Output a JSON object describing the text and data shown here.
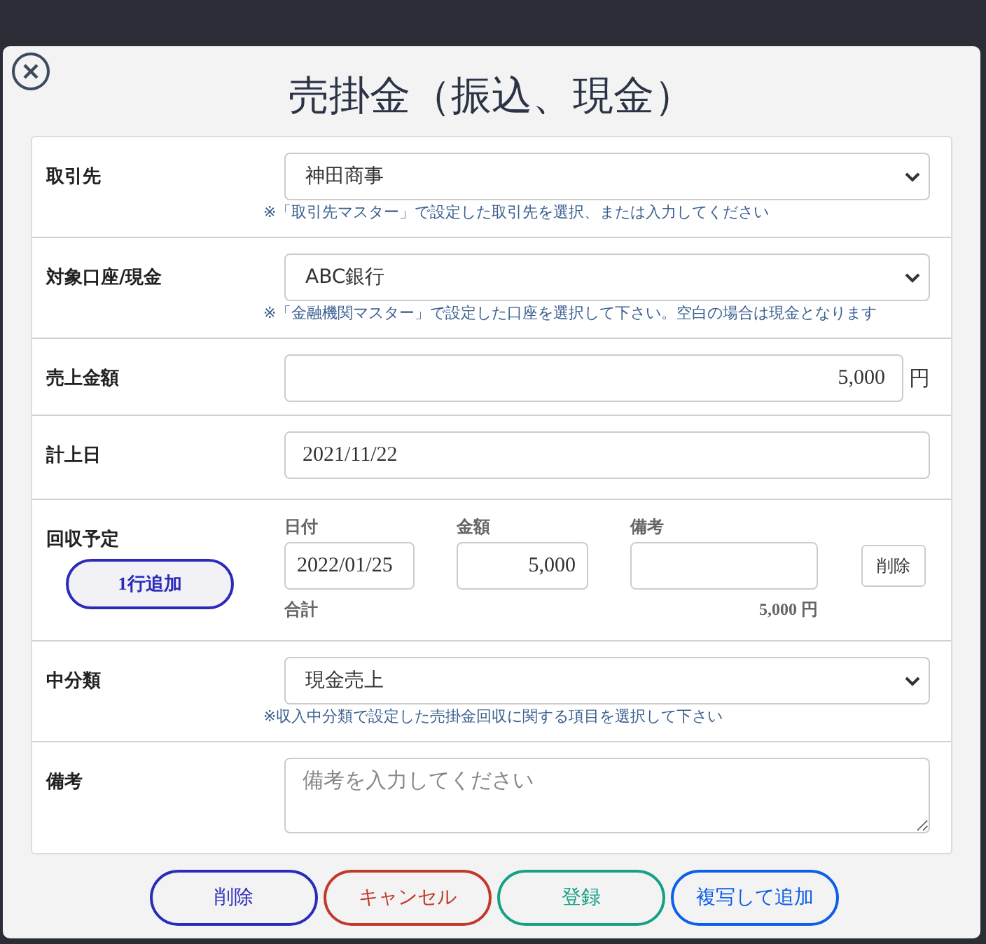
{
  "title": "売掛金（振込、現金）",
  "fields": [
    {
      "kind": "select",
      "label": "取引先",
      "value": "神田商事",
      "note": "※「取引先マスター」で設定した取引先を選択、または入力してください"
    },
    {
      "kind": "select",
      "label": "対象口座/現金",
      "value": "ABC銀行",
      "note": "※「金融機関マスター」で設定した口座を選択して下さい。空白の場合は現金となります"
    },
    {
      "kind": "amount",
      "label": "売上金額",
      "value": "5,000",
      "unit": "円"
    },
    {
      "kind": "text",
      "label": "計上日",
      "value": "2021/11/22"
    },
    {
      "kind": "schedule",
      "label": "回収予定",
      "add_button": "1行追加",
      "columns": [
        "日付",
        "金額",
        "備考"
      ],
      "rows": [
        {
          "date": "2022/01/25",
          "amount": "5,000",
          "delete_button": "削除"
        }
      ],
      "total_label": "合計",
      "total": "5,000 円"
    },
    {
      "kind": "select",
      "label": "中分類",
      "value": "現金売上",
      "note": "※収入中分類で設定した売掛金回収に関する項目を選択して下さい"
    },
    {
      "kind": "textarea",
      "label": "備考",
      "placeholder": "備考を入力してください"
    }
  ],
  "buttons": [
    {
      "label": "削除",
      "color": "#2b2bbb"
    },
    {
      "label": "キャンセル",
      "color": "#c0392b"
    },
    {
      "label": "登録",
      "color": "#16a085"
    },
    {
      "label": "複写して追加",
      "color": "#0d5ee8"
    }
  ]
}
